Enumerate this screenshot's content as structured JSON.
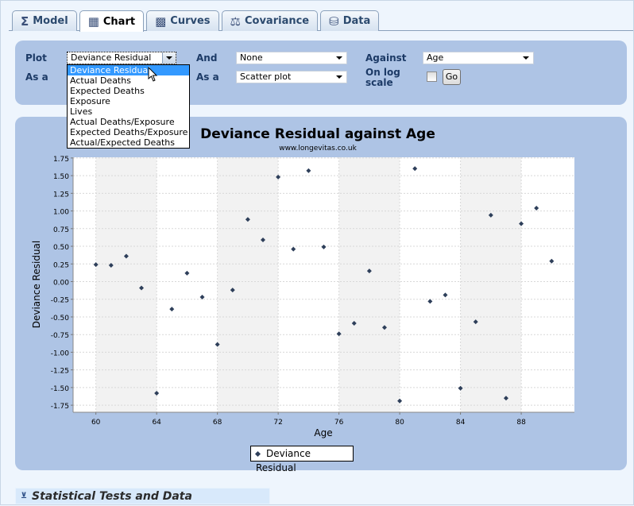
{
  "tabs": [
    {
      "label": "Model",
      "icon": "sigma-icon"
    },
    {
      "label": "Chart",
      "icon": "chart-icon",
      "active": true
    },
    {
      "label": "Curves",
      "icon": "curves-icon"
    },
    {
      "label": "Covariance",
      "icon": "scales-icon"
    },
    {
      "label": "Data",
      "icon": "database-icon"
    }
  ],
  "controls": {
    "plot_label": "Plot",
    "plot_value": "Deviance Residual",
    "asa_label": "As a",
    "and_label": "And",
    "and_value": "None",
    "asa2_label": "As a",
    "asa2_value": "Scatter plot",
    "against_label": "Against",
    "against_value": "Age",
    "log_label": "On log scale",
    "log_checked": false,
    "go_label": "Go",
    "plot_options": [
      "Deviance Residual",
      "Actual Deaths",
      "Expected Deaths",
      "Exposure",
      "Lives",
      "Actual Deaths/Exposure",
      "Expected Deaths/Exposure",
      "Actual/Expected Deaths"
    ]
  },
  "chart_data": {
    "type": "scatter",
    "title": "Deviance Residual against Age",
    "subtitle": "www.longevitas.co.uk",
    "xlabel": "Age",
    "ylabel": "Deviance Residual",
    "xlim": [
      58.5,
      91.5
    ],
    "ylim": [
      -1.85,
      1.76
    ],
    "xticks": [
      60,
      64,
      68,
      72,
      76,
      80,
      84,
      88
    ],
    "yticks": [
      "1.75",
      "1.50",
      "1.25",
      "1.00",
      "0.75",
      "0.50",
      "0.25",
      "0.00",
      "-0.25",
      "-0.50",
      "-0.75",
      "-1.00",
      "-1.25",
      "-1.50",
      "-1.75"
    ],
    "grid": true,
    "legend": "bottom-center",
    "series": [
      {
        "name": "Deviance Residual",
        "color": "#2e3f5a",
        "x": [
          60,
          61,
          62,
          63,
          64,
          65,
          66,
          67,
          68,
          69,
          70,
          71,
          72,
          73,
          74,
          75,
          76,
          77,
          78,
          79,
          80,
          81,
          82,
          83,
          84,
          85,
          86,
          87,
          88,
          89,
          90
        ],
        "y": [
          0.24,
          0.23,
          0.36,
          -0.09,
          -1.58,
          -0.39,
          0.12,
          -0.22,
          -0.89,
          -0.12,
          0.88,
          0.59,
          1.48,
          0.46,
          1.57,
          0.49,
          -0.74,
          -0.59,
          0.15,
          -0.65,
          -1.69,
          1.6,
          -0.28,
          -0.19,
          -1.51,
          -0.57,
          0.94,
          -1.65,
          0.82,
          1.04,
          0.29
        ]
      }
    ]
  },
  "footer": {
    "section_label": "Statistical Tests and Data"
  }
}
